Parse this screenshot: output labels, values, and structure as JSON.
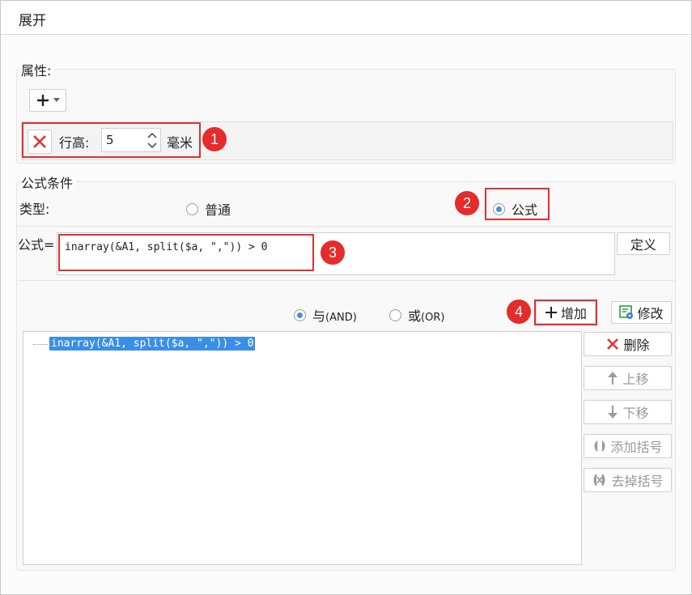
{
  "title": "展开",
  "properties": {
    "legend": "属性:",
    "row_height_label": "行高:",
    "row_height_value": "5",
    "row_height_unit": "毫米"
  },
  "formula_condition": {
    "legend": "公式条件",
    "type_label": "类型:",
    "type_options": [
      "普通",
      "公式"
    ],
    "type_selected": "公式",
    "formula_label": "公式=",
    "formula_value": "inarray(&A1, split($a, \",\")) > 0",
    "define_button": "定义",
    "logic_and": "与",
    "logic_and_tag": "(AND)",
    "logic_or": "或",
    "logic_or_tag": "(OR)",
    "logic_selected": "与",
    "add_button": "增加",
    "modify_button": "修改",
    "conditions": [
      "inarray(&A1, split($a, \",\")) > 0"
    ],
    "actions": {
      "delete": "删除",
      "move_up": "上移",
      "move_down": "下移",
      "add_bracket": "添加括号",
      "remove_bracket": "去掉括号"
    }
  },
  "annotations": [
    "1",
    "2",
    "3",
    "4"
  ],
  "colors": {
    "annotation_red": "#e52b2b",
    "selection_blue": "#3a8ee6",
    "radio_blue": "#4a8de0"
  }
}
